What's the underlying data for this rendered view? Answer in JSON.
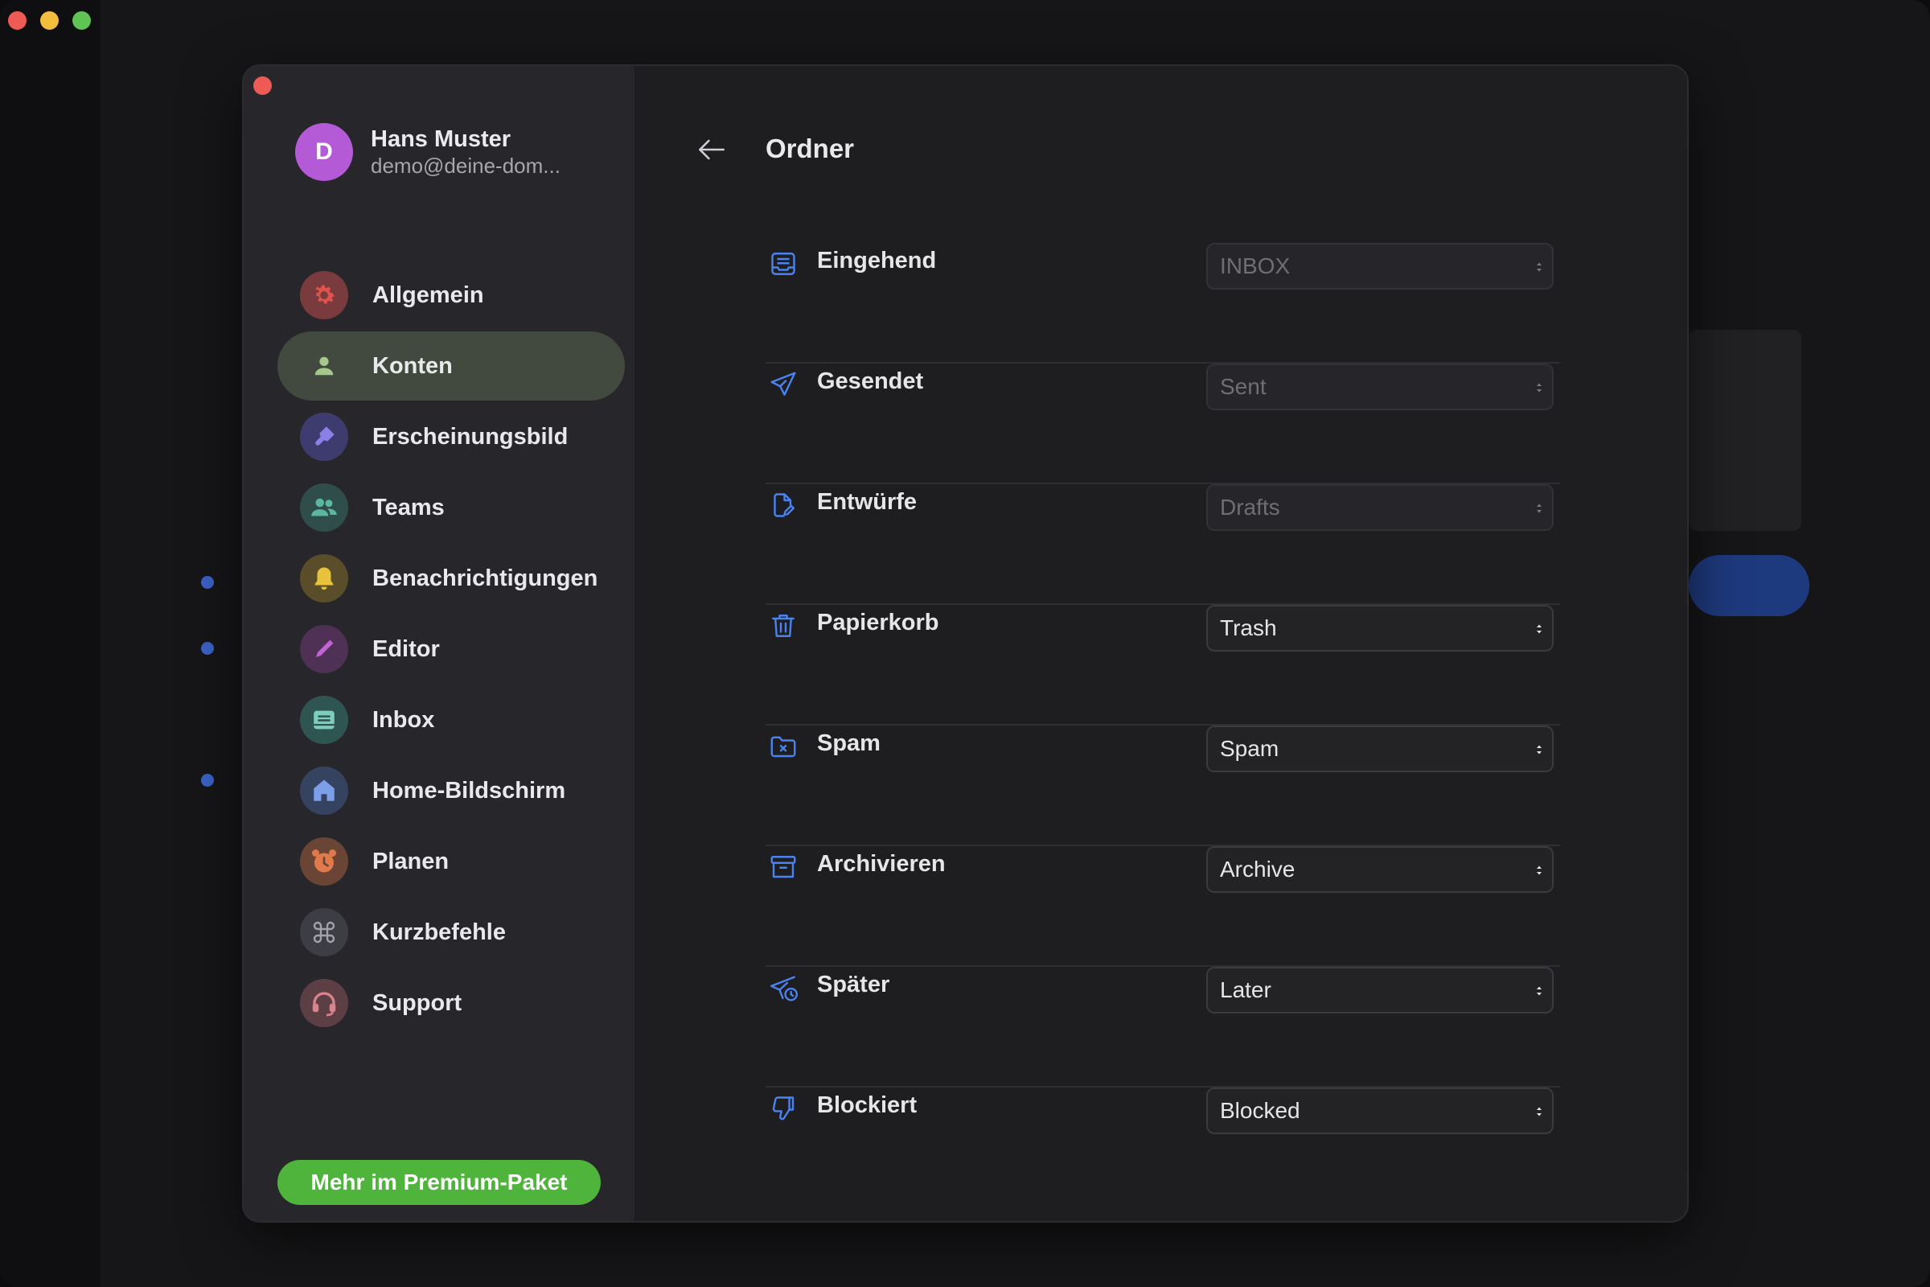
{
  "profile": {
    "initial": "D",
    "name": "Hans Muster",
    "email": "demo@deine-dom..."
  },
  "nav": [
    {
      "label": "Allgemein",
      "icon": "gear-icon",
      "color": "#7a3b3e",
      "icon_color": "#e0534c"
    },
    {
      "label": "Konten",
      "icon": "person-icon",
      "color": "#424a3f",
      "icon_color": "#a5c98a",
      "active": true
    },
    {
      "label": "Erscheinungsbild",
      "icon": "paintbrush-icon",
      "color": "#3e3c6e",
      "icon_color": "#8b7fe8"
    },
    {
      "label": "Teams",
      "icon": "people-icon",
      "color": "#2f4e4a",
      "icon_color": "#5bb6a2"
    },
    {
      "label": "Benachrichtigungen",
      "icon": "bell-icon",
      "color": "#5a4e2a",
      "icon_color": "#e9c23d"
    },
    {
      "label": "Editor",
      "icon": "pen-icon",
      "color": "#4e3155",
      "icon_color": "#c463d8"
    },
    {
      "label": "Inbox",
      "icon": "inbox-icon",
      "color": "#2f5552",
      "icon_color": "#7fcdbf"
    },
    {
      "label": "Home-Bildschirm",
      "icon": "home-icon",
      "color": "#354260",
      "icon_color": "#7d9ee8"
    },
    {
      "label": "Planen",
      "icon": "alarm-clock-icon",
      "color": "#6a4535",
      "icon_color": "#e07a4d"
    },
    {
      "label": "Kurzbefehle",
      "icon": "command-icon",
      "color": "#3d3d44",
      "icon_color": "#a2a2aa"
    },
    {
      "label": "Support",
      "icon": "headset-icon",
      "color": "#5c3f45",
      "icon_color": "#d9848c"
    }
  ],
  "premium_label": "Mehr im Premium-Paket",
  "page_title": "Ordner",
  "folders": [
    {
      "label": "Eingehend",
      "icon": "inbox-tray-icon",
      "value": "INBOX",
      "disabled": true
    },
    {
      "label": "Gesendet",
      "icon": "paper-plane-icon",
      "value": "Sent",
      "disabled": true
    },
    {
      "label": "Entwürfe",
      "icon": "draft-document-icon",
      "value": "Drafts",
      "disabled": true
    },
    {
      "label": "Papierkorb",
      "icon": "trash-icon",
      "value": "Trash",
      "disabled": false
    },
    {
      "label": "Spam",
      "icon": "spam-folder-icon",
      "value": "Spam",
      "disabled": false
    },
    {
      "label": "Archivieren",
      "icon": "archive-box-icon",
      "value": "Archive",
      "disabled": false
    },
    {
      "label": "Später",
      "icon": "send-later-icon",
      "value": "Later",
      "disabled": false
    },
    {
      "label": "Blockiert",
      "icon": "thumbs-down-icon",
      "value": "Blocked",
      "disabled": false
    }
  ],
  "colors": {
    "accent_blue": "#4a83f0",
    "premium_green": "#4fb43c",
    "active_nav_bg": "#424a3f",
    "avatar_purple": "#b45ad6"
  }
}
